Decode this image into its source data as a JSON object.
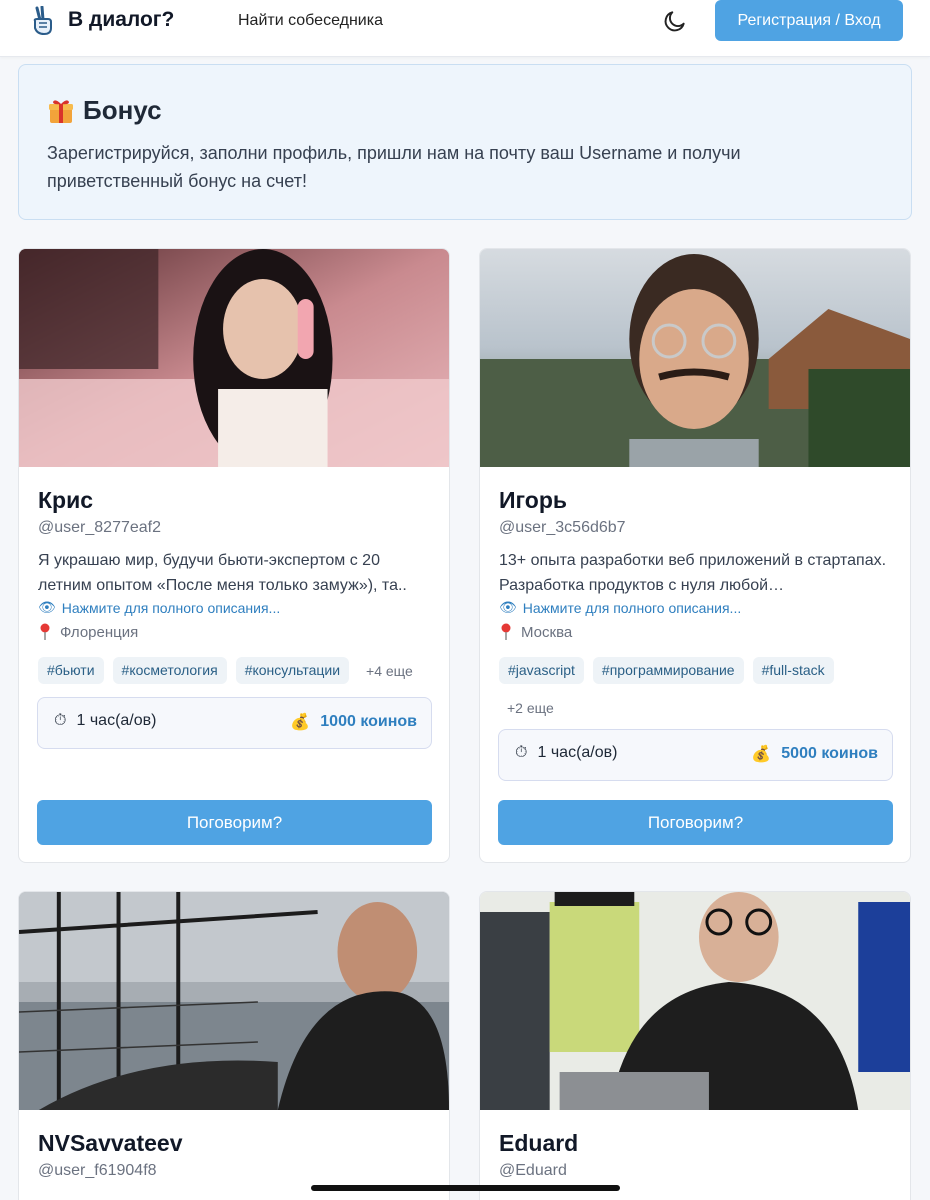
{
  "header": {
    "brand": "В диалог?",
    "nav_find": "Найти собеседника",
    "login_label": "Регистрация / Вход",
    "logo_icon": "victory-hand-icon",
    "theme_icon": "moon-icon"
  },
  "bonus": {
    "icon": "gift-icon",
    "title": "Бонус",
    "text": "Зарегистрируйся, заполни профиль, пришли нам на почту ваш Username и получи приветственный бонус на счет!"
  },
  "colors": {
    "accent": "#4fa3e3",
    "link": "#2f7fbf",
    "bonus_bg": "#eef5fc"
  },
  "cards": [
    {
      "name": "Крис",
      "username": "@user_8277eaf2",
      "bio": "Я украшаю мир, будучи бьюти-экспертом с 20 летним опытом «После меня только замуж»), та..",
      "more_link": "Нажмите для полного описания...",
      "city": "Флоренция",
      "tags": [
        "#бьюти",
        "#косметология",
        "#консультации"
      ],
      "tags_more": "+4 еще",
      "duration": "1 час(а/ов)",
      "price": "1000 коинов",
      "button": "Поговорим?"
    },
    {
      "name": "Игорь",
      "username": "@user_3c56d6b7",
      "bio": "13+ опыта разработки веб приложений в стартапах. Разработка продуктов с нуля любой…",
      "more_link": "Нажмите для полного описания...",
      "city": "Москва",
      "tags": [
        "#javascript",
        "#программирование",
        "#full-stack"
      ],
      "tags_more": "+2 еще",
      "duration": "1 час(а/ов)",
      "price": "5000 коинов",
      "button": "Поговорим?"
    },
    {
      "name": "NVSavvateev",
      "username": "@user_f61904f8"
    },
    {
      "name": "Eduard",
      "username": "@Eduard"
    }
  ]
}
